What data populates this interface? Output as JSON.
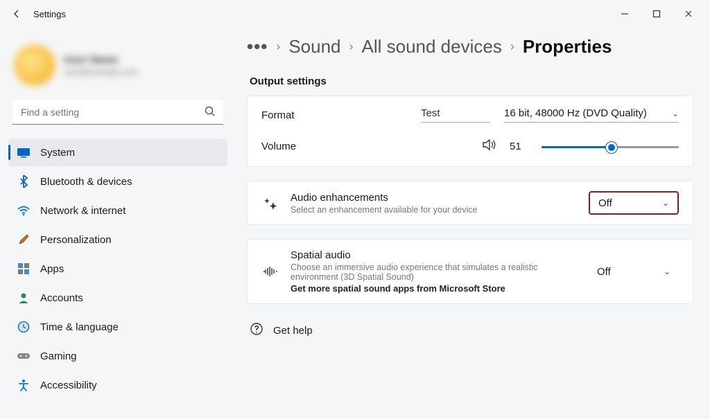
{
  "window": {
    "title": "Settings"
  },
  "profile": {
    "name": "User Name",
    "email": "user@example.com"
  },
  "search": {
    "placeholder": "Find a setting"
  },
  "sidebar": {
    "items": [
      {
        "label": "System"
      },
      {
        "label": "Bluetooth & devices"
      },
      {
        "label": "Network & internet"
      },
      {
        "label": "Personalization"
      },
      {
        "label": "Apps"
      },
      {
        "label": "Accounts"
      },
      {
        "label": "Time & language"
      },
      {
        "label": "Gaming"
      },
      {
        "label": "Accessibility"
      }
    ]
  },
  "breadcrumb": {
    "sound": "Sound",
    "all_devices": "All sound devices",
    "properties": "Properties"
  },
  "output": {
    "section": "Output settings",
    "format_label": "Format",
    "test_label": "Test",
    "format_value": "16 bit, 48000 Hz (DVD Quality)",
    "volume_label": "Volume",
    "volume_value": "51"
  },
  "enhancements": {
    "title": "Audio enhancements",
    "desc": "Select an enhancement available for your device",
    "value": "Off"
  },
  "spatial": {
    "title": "Spatial audio",
    "desc": "Choose an immersive audio experience that simulates a realistic environment (3D Spatial Sound)",
    "link": "Get more spatial sound apps from Microsoft Store",
    "value": "Off"
  },
  "help": {
    "label": "Get help"
  }
}
